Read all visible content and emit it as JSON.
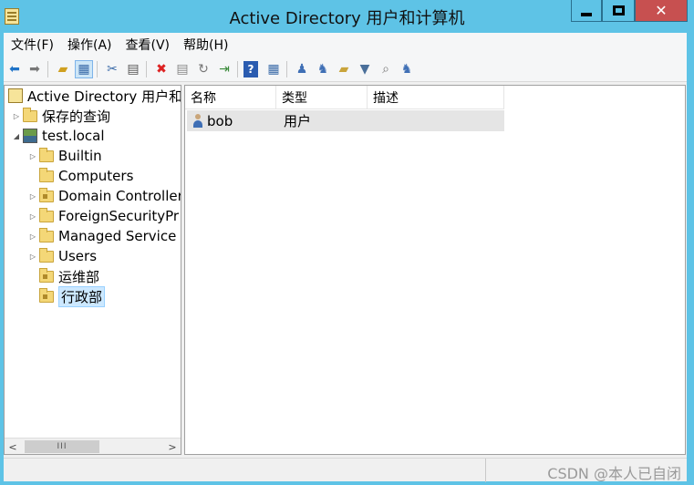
{
  "window": {
    "title": "Active Directory 用户和计算机",
    "close_glyph": "✕"
  },
  "menu": [
    "文件(F)",
    "操作(A)",
    "查看(V)",
    "帮助(H)"
  ],
  "toolbar": {
    "icons": [
      "back-arrow-icon",
      "forward-arrow-icon",
      "up-folder-icon",
      "show-hide-tree-icon",
      "cut-icon",
      "copy-icon",
      "delete-icon",
      "properties-icon",
      "refresh-icon",
      "export-list-icon",
      "help-icon",
      "console-tree-icon",
      "new-user-icon",
      "new-group-icon",
      "new-ou-icon",
      "filter-icon",
      "find-icon",
      "add-to-group-icon"
    ]
  },
  "tree": {
    "root": "Active Directory 用户和",
    "items": [
      {
        "label": "保存的查询",
        "level": 1,
        "expander": "▷",
        "icon": "folder"
      },
      {
        "label": "test.local",
        "level": 1,
        "expander": "◢",
        "icon": "domain"
      },
      {
        "label": "Builtin",
        "level": 2,
        "expander": "▷",
        "icon": "folder"
      },
      {
        "label": "Computers",
        "level": 2,
        "expander": "",
        "icon": "folder"
      },
      {
        "label": "Domain Controller",
        "level": 2,
        "expander": "▷",
        "icon": "ou"
      },
      {
        "label": "ForeignSecurityPr",
        "level": 2,
        "expander": "▷",
        "icon": "folder"
      },
      {
        "label": "Managed Service",
        "level": 2,
        "expander": "▷",
        "icon": "folder"
      },
      {
        "label": "Users",
        "level": 2,
        "expander": "▷",
        "icon": "folder"
      },
      {
        "label": "运维部",
        "level": 2,
        "expander": "",
        "icon": "ou"
      },
      {
        "label": "行政部",
        "level": 2,
        "expander": "",
        "icon": "ou",
        "selected": true
      }
    ],
    "scroll": {
      "left": "<",
      "right": ">",
      "thumb": "III"
    }
  },
  "list": {
    "columns": [
      "名称",
      "类型",
      "描述"
    ],
    "rows": [
      {
        "name": "bob",
        "type": "用户",
        "description": ""
      }
    ]
  },
  "status": {
    "watermark": "CSDN @本人已自闭"
  }
}
